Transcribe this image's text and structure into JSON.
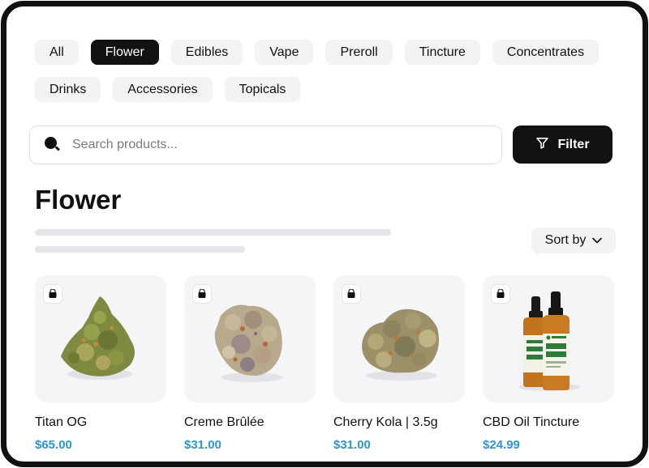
{
  "categories": {
    "row1": [
      {
        "label": "All",
        "active": false
      },
      {
        "label": "Flower",
        "active": true
      },
      {
        "label": "Edibles",
        "active": false
      },
      {
        "label": "Vape",
        "active": false
      },
      {
        "label": "Preroll",
        "active": false
      },
      {
        "label": "Tincture",
        "active": false
      },
      {
        "label": "Concentrates",
        "active": false
      }
    ],
    "row2": [
      {
        "label": "Drinks",
        "active": false
      },
      {
        "label": "Accessories",
        "active": false
      },
      {
        "label": "Topicals",
        "active": false
      }
    ]
  },
  "search": {
    "placeholder": "Search products...",
    "value": ""
  },
  "filter": {
    "label": "Filter"
  },
  "page": {
    "title": "Flower"
  },
  "sort": {
    "label": "Sort by"
  },
  "products": [
    {
      "name": "Titan OG",
      "price": "$65.00",
      "image": "flower-bud"
    },
    {
      "name": "Creme Brûlée",
      "price": "$31.00",
      "image": "flower-bud"
    },
    {
      "name": "Cherry Kola | 3.5g",
      "price": "$31.00",
      "image": "flower-bud"
    },
    {
      "name": "CBD Oil Tincture",
      "price": "$24.99",
      "image": "tincture-bottles"
    }
  ],
  "colors": {
    "accent_price": "#2b95d6",
    "active_chip": "#121212",
    "chip_bg": "#f2f3f5"
  }
}
